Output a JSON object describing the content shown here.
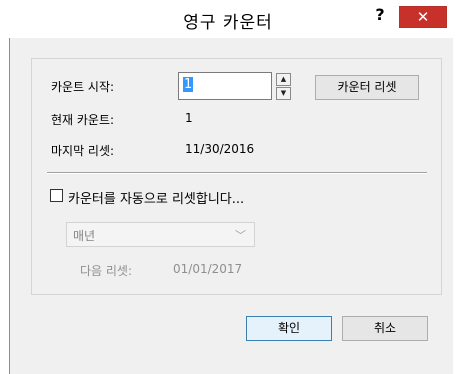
{
  "window": {
    "title": "영구 카운터",
    "help_label": "?",
    "close_label": "✕"
  },
  "counter": {
    "start_label": "카운트 시작:",
    "start_value": "1",
    "current_label": "현재 카운트:",
    "current_value": "1",
    "last_reset_label": "마지막 리셋:",
    "last_reset_value": "11/30/2016",
    "reset_button": "카운터 리셋"
  },
  "auto_reset": {
    "checkbox_label": "카운터를 자동으로 리셋합니다...",
    "checked": false,
    "frequency_selected": "매년",
    "next_reset_label": "다음 리셋:",
    "next_reset_value": "01/01/2017"
  },
  "footer": {
    "ok_label": "확인",
    "cancel_label": "취소"
  },
  "icons": {
    "spin_up": "spin-up-arrow-icon",
    "spin_down": "spin-down-arrow-icon",
    "dropdown": "chevron-down-icon"
  }
}
